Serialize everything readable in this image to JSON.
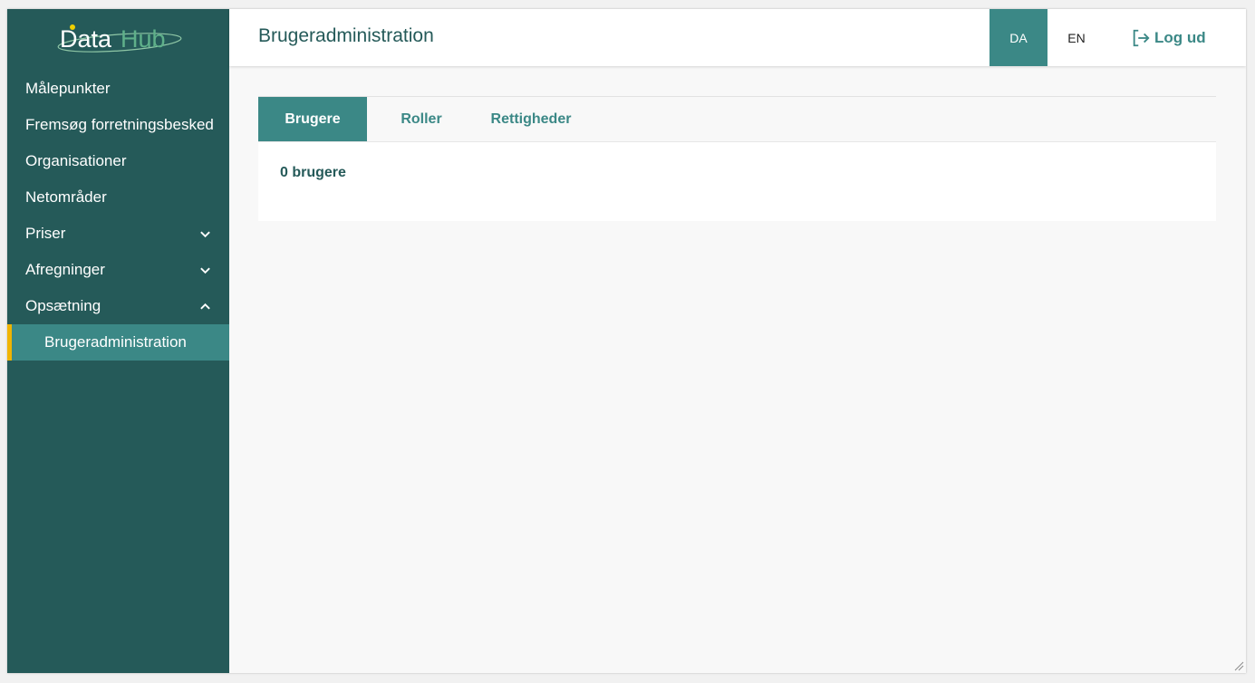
{
  "app": {
    "logo_text_primary": "Data",
    "logo_text_secondary": "Hub"
  },
  "sidebar": {
    "items": [
      {
        "label": "Målepunkter"
      },
      {
        "label": "Fremsøg forretningsbesked"
      },
      {
        "label": "Organisationer"
      },
      {
        "label": "Netområder"
      },
      {
        "label": "Priser",
        "chevron": "chevron-down-icon"
      },
      {
        "label": "Afregninger",
        "chevron": "chevron-down-icon"
      },
      {
        "label": "Opsætning",
        "chevron": "chevron-up-icon"
      }
    ],
    "sub_item": {
      "label": "Brugeradministration",
      "active": true
    }
  },
  "header": {
    "title": "Brugeradministration",
    "lang_da": "DA",
    "lang_en": "EN",
    "logout_label": "Log ud",
    "logout_icon": "logout-icon"
  },
  "tabs": [
    {
      "label": "Brugere",
      "active": true
    },
    {
      "label": "Roller",
      "active": false
    },
    {
      "label": "Rettigheder",
      "active": false
    }
  ],
  "panel": {
    "count_text": "0 brugere"
  },
  "colors": {
    "sidebar_bg": "#255a59",
    "accent": "#3b8886",
    "active_indicator": "#f0b400",
    "title_text": "#255a59"
  }
}
